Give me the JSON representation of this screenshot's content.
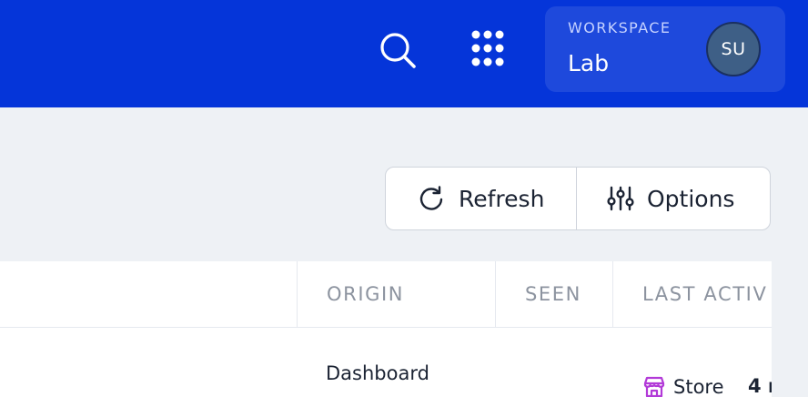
{
  "header": {
    "workspace_label": "WORKSPACE",
    "workspace_name": "Lab",
    "avatar_initials": "SU",
    "icons": [
      "search-icon",
      "apps-grid-icon"
    ]
  },
  "toolbar": {
    "refresh_label": "Refresh",
    "options_label": "Options",
    "icons": [
      "refresh-icon",
      "sliders-icon"
    ]
  },
  "table": {
    "columns": [
      "ORIGIN",
      "SEEN",
      "LAST ACTIV"
    ],
    "rows": [
      {
        "origin": "Dashboard",
        "last_activity_type": "Store",
        "last_activity_time": "4 r"
      }
    ]
  },
  "colors": {
    "topbar": "#0535d9",
    "background": "#eef1f5",
    "store_icon": "#b23ad8"
  }
}
